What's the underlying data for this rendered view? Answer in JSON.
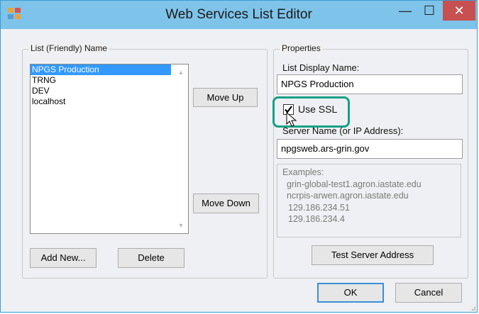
{
  "window": {
    "title": "Web Services List Editor",
    "minimize_glyph": "—",
    "maximize_glyph": "☐",
    "close_glyph": "✕"
  },
  "left_panel": {
    "group_label": "List (Friendly) Name",
    "items": [
      "NPGS Production",
      "TRNG",
      "DEV",
      "localhost"
    ],
    "selected_index": 0
  },
  "buttons": {
    "move_up": "Move Up",
    "move_down": "Move Down",
    "add_new": "Add New...",
    "delete": "Delete",
    "test_server": "Test Server Address",
    "ok": "OK",
    "cancel": "Cancel"
  },
  "properties": {
    "group_label": "Properties",
    "display_name_label": "List Display Name:",
    "display_name_value": "NPGS Production",
    "use_ssl_label": "Use SSL",
    "use_ssl_checked": true,
    "server_name_label": "Server Name (or IP Address):",
    "server_name_value": "npgsweb.ars-grin.gov",
    "examples_label": "Examples:",
    "examples": [
      "grin-global-test1.agron.iastate.edu",
      "ncrpis-arwen.agron.iastate.edu",
      "129.186.234.51",
      "129.186.234.4"
    ]
  },
  "colors": {
    "titlebar": "#7ec3ea",
    "selection": "#3399ff",
    "close_button": "#c75050",
    "highlight_ring": "#16a085"
  }
}
